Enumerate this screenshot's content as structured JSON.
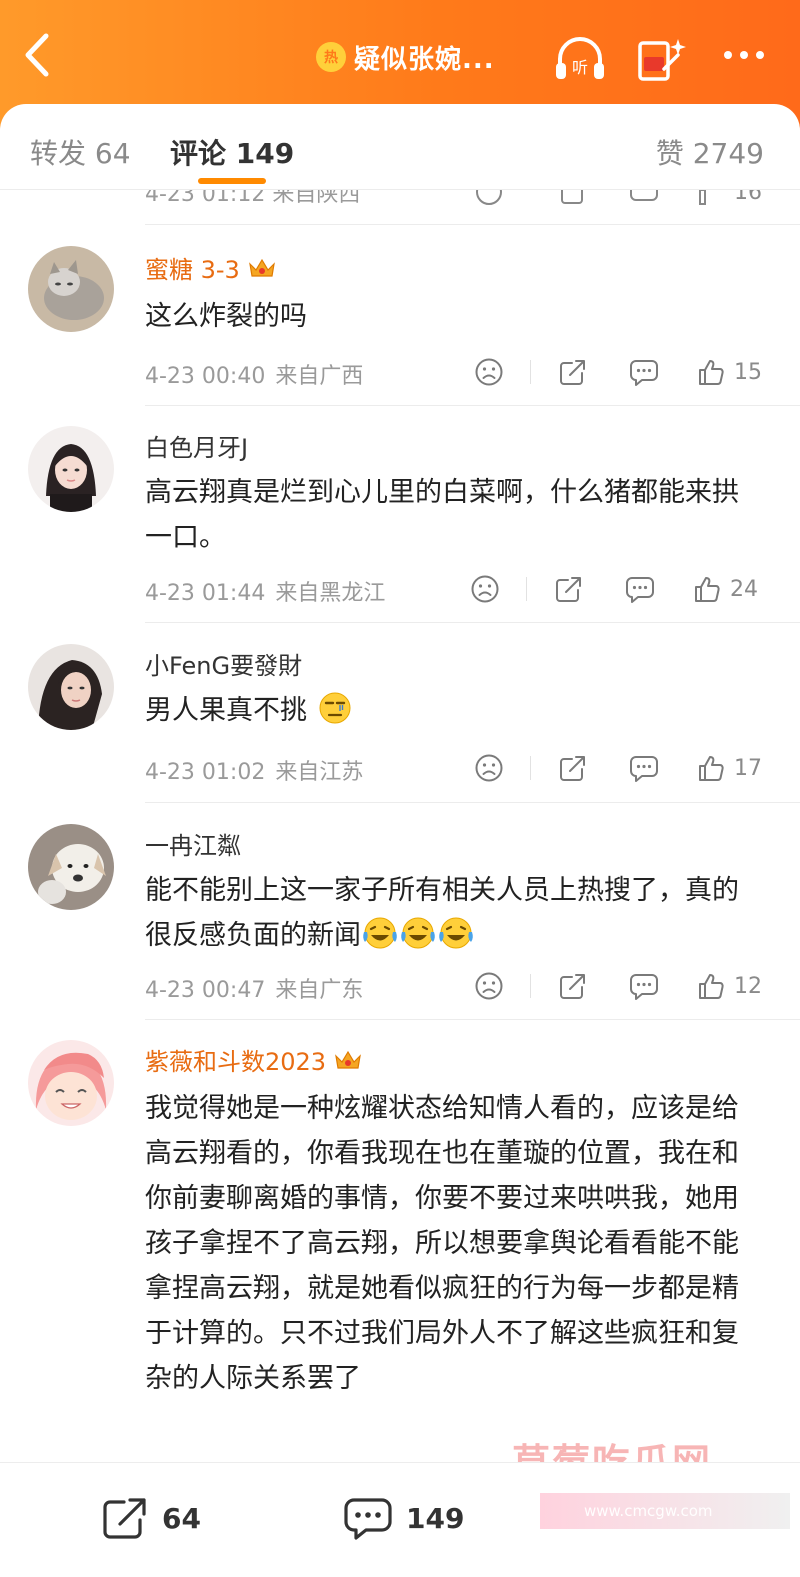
{
  "header": {
    "hot_badge": "热",
    "title": "疑似张婉...",
    "listen_label": "听"
  },
  "tabs": {
    "repost": "转发 64",
    "comment": "评论 149",
    "like": "赞 2749"
  },
  "partial_row": {
    "meta": "4-23 01:12 来自陕西",
    "likes": "16"
  },
  "comments": [
    {
      "name": "蜜糖 3-3",
      "vip": true,
      "text": "这么炸裂的吗",
      "time": "4-23 00:40",
      "location": "来自广西",
      "likes": "15"
    },
    {
      "name": "白色月牙J",
      "vip": false,
      "text": "高云翔真是烂到心儿里的白菜啊，什么猪都能来拱一口。",
      "time": "4-23 01:44",
      "location": "来自黑龙江",
      "likes": "24"
    },
    {
      "name": "小FenG要發財",
      "vip": false,
      "text": "男人果真不挑",
      "time": "4-23 01:02",
      "location": "来自江苏",
      "likes": "17"
    },
    {
      "name": "一冉江粼",
      "vip": false,
      "text": "能不能别上这一家子所有相关人员上热搜了，真的很反感负面的新闻",
      "time": "4-23 00:47",
      "location": "来自广东",
      "likes": "12"
    },
    {
      "name": "紫薇和斗数2023",
      "vip": true,
      "text": "我觉得她是一种炫耀状态给知情人看的，应该是给高云翔看的，你看我现在也在董璇的位置，我在和你前妻聊离婚的事情，你要不要过来哄哄我，她用孩子拿捏不了高云翔，所以想要拿舆论看看能不能拿捏高云翔，就是她看似疯狂的行为每一步都是精于计算的。只不过我们局外人不了解这些疯狂和复杂的人际关系罢了"
    }
  ],
  "bottom_bar": {
    "share_count": "64",
    "reply_count": "149"
  },
  "watermark": {
    "title": "草莓吃瓜网",
    "url": "www.cmcgw.com"
  },
  "colors": {
    "brand_orange": "#ff7a1a",
    "vip_name": "#e86c12",
    "tab_underline": "#ff8a00"
  }
}
